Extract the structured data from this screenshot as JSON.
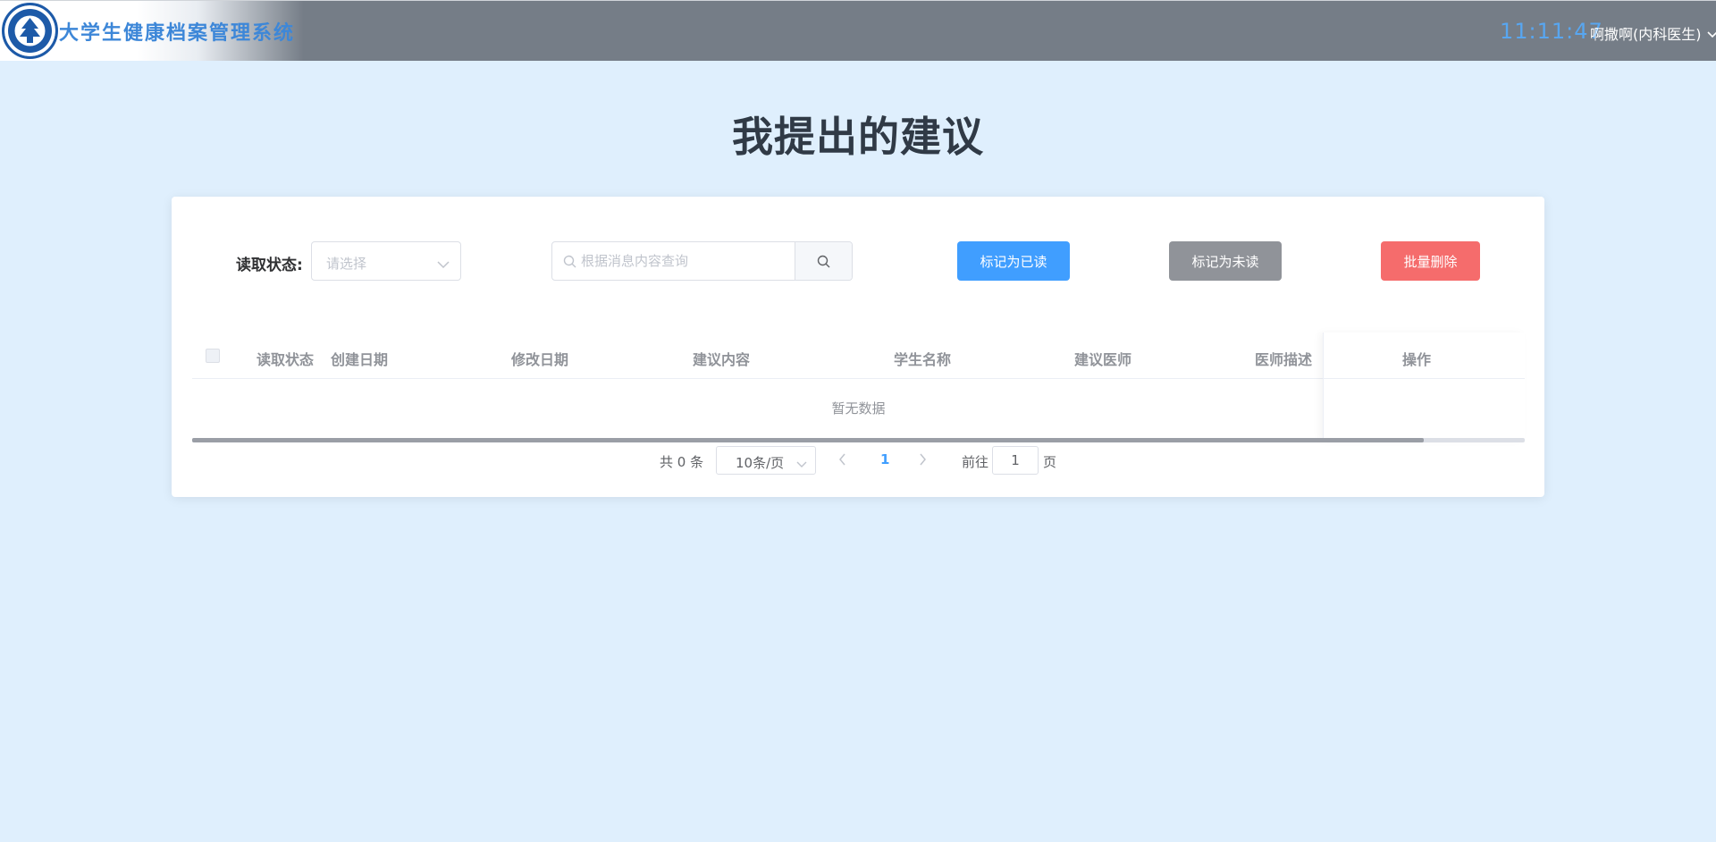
{
  "header": {
    "system_title": "大学生健康档案管理系统",
    "clock": "11:11:47",
    "user_label": "啊撒啊(内科医生)",
    "bg_color": "#757d87"
  },
  "page": {
    "title": "我提出的建议"
  },
  "filters": {
    "read_status_label": "读取状态:",
    "read_status_placeholder": "请选择",
    "search_placeholder": "根据消息内容查询"
  },
  "actions": {
    "mark_read": "标记为已读",
    "mark_unread": "标记为未读",
    "batch_delete": "批量删除",
    "colors": {
      "primary": "#409eff",
      "info": "#909399",
      "danger": "#f56c6c"
    }
  },
  "table": {
    "columns": [
      "读取状态",
      "创建日期",
      "修改日期",
      "建议内容",
      "学生名称",
      "建议医师",
      "医师描述",
      "操作"
    ],
    "empty_text": "暂无数据"
  },
  "pagination": {
    "total_text": "共 0 条",
    "page_size": "10条/页",
    "current_page": "1",
    "goto_label": "前往",
    "goto_value": "1",
    "page_unit": "页"
  }
}
